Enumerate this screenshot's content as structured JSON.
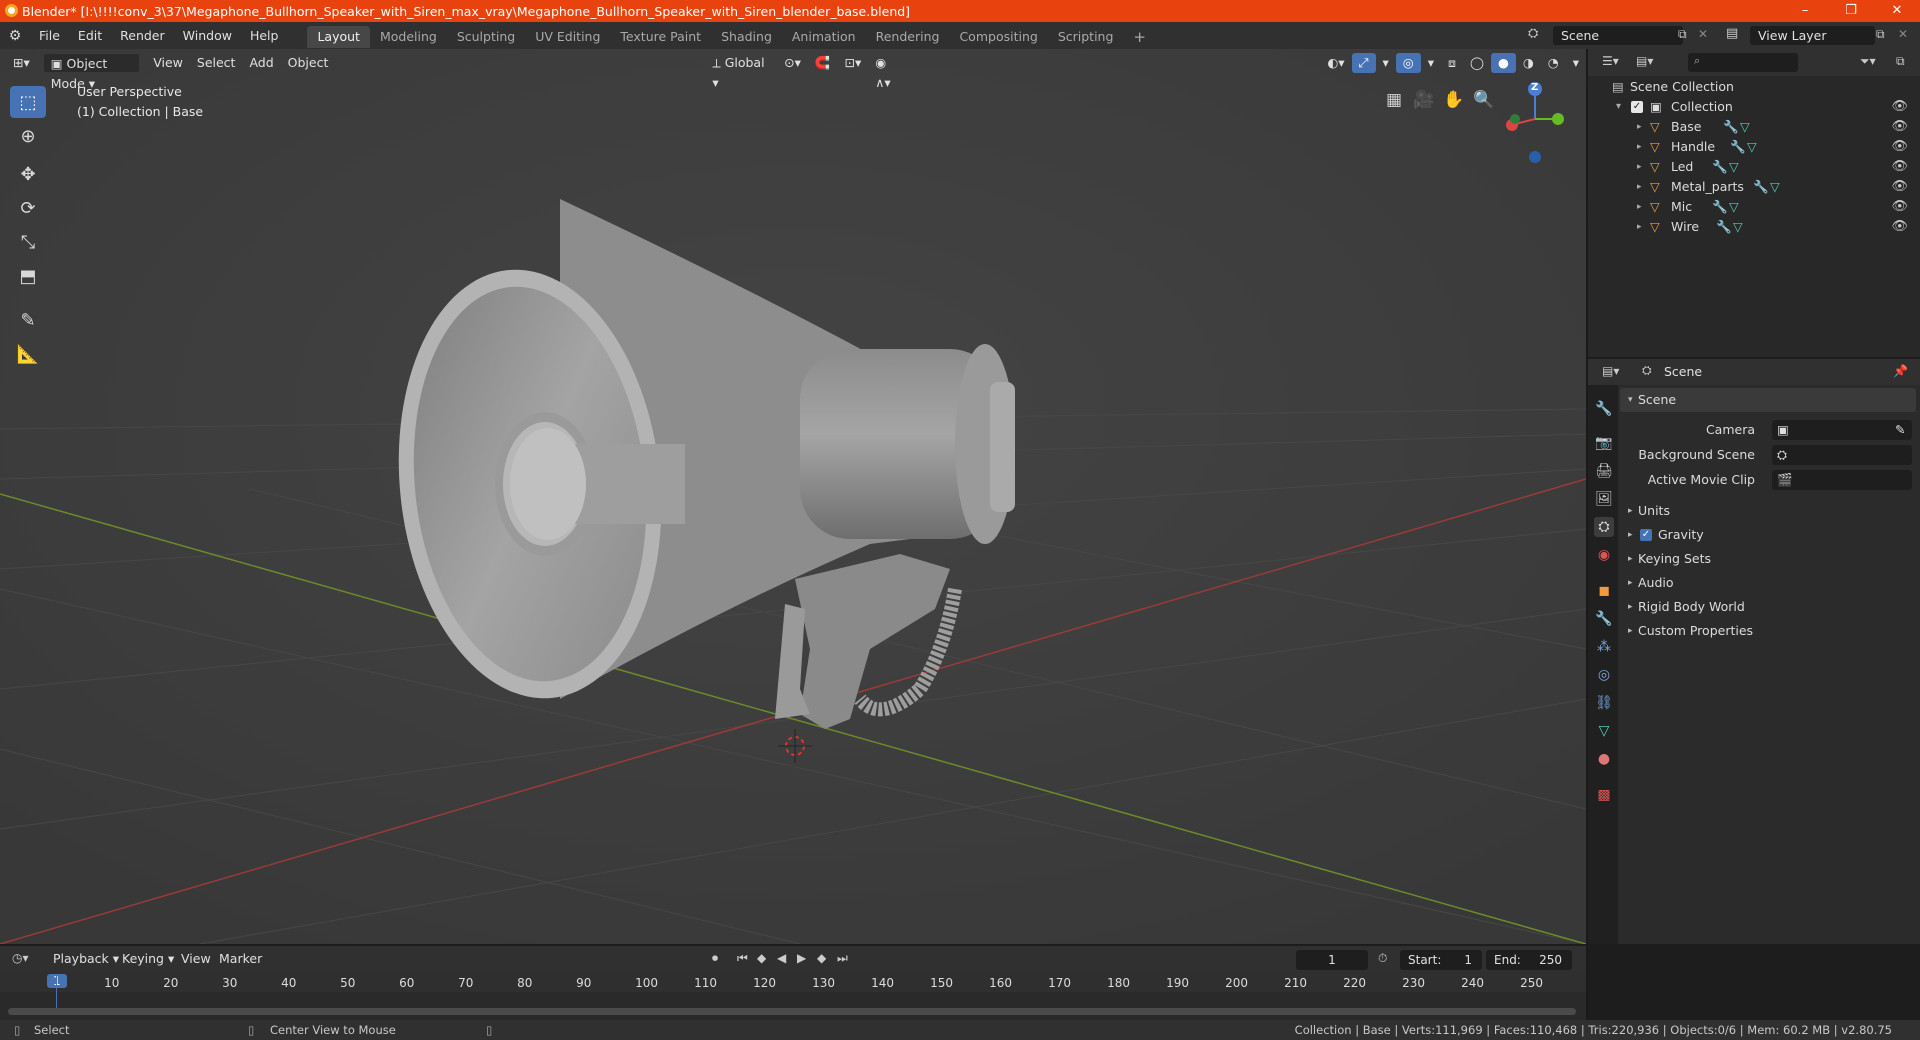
{
  "window": {
    "title": "Blender* [I:\\!!!!conv_3\\37\\Megaphone_Bullhorn_Speaker_with_Siren_max_vray\\Megaphone_Bullhorn_Speaker_with_Siren_blender_base.blend]",
    "minimize": "–",
    "maximize": "❐",
    "close": "✕"
  },
  "menubar": {
    "items": [
      "File",
      "Edit",
      "Render",
      "Window",
      "Help"
    ],
    "workspaces": [
      "Layout",
      "Modeling",
      "Sculpting",
      "UV Editing",
      "Texture Paint",
      "Shading",
      "Animation",
      "Rendering",
      "Compositing",
      "Scripting"
    ],
    "active_workspace": "Layout",
    "add_workspace": "+",
    "scene_name": "Scene",
    "view_layer": "View Layer"
  },
  "viewport_header": {
    "mode": "Object Mode",
    "menus": [
      "View",
      "Select",
      "Add",
      "Object"
    ],
    "transform_orientation": "Global"
  },
  "viewport": {
    "perspective_label": "User Perspective",
    "collection_label": "(1) Collection | Base",
    "gizmo_z": "Z"
  },
  "outliner": {
    "root": "Scene Collection",
    "collection": "Collection",
    "objects": [
      "Base",
      "Handle",
      "Led",
      "Metal_parts",
      "Mic",
      "Wire"
    ]
  },
  "properties": {
    "header": "Scene",
    "panel_title": "Scene",
    "fields": [
      {
        "label": "Camera",
        "value": ""
      },
      {
        "label": "Background Scene",
        "value": ""
      },
      {
        "label": "Active Movie Clip",
        "value": ""
      }
    ],
    "subpanels": [
      "Units",
      "Gravity",
      "Keying Sets",
      "Audio",
      "Rigid Body World",
      "Custom Properties"
    ],
    "gravity_checked": true
  },
  "timeline": {
    "menus": [
      "Playback",
      "Keying",
      "View",
      "Marker"
    ],
    "current_frame": "1",
    "start_label": "Start:",
    "start": "1",
    "end_label": "End:",
    "end": "250",
    "ruler": [
      "1",
      "10",
      "20",
      "30",
      "40",
      "50",
      "60",
      "70",
      "80",
      "90",
      "100",
      "110",
      "120",
      "130",
      "140",
      "150",
      "160",
      "170",
      "180",
      "190",
      "200",
      "210",
      "220",
      "230",
      "240",
      "250"
    ]
  },
  "statusbar": {
    "left_action": "Select",
    "middle_action": "Center View to Mouse",
    "stats": "Collection | Base | Verts:111,969 | Faces:110,468 | Tris:220,936 | Objects:0/6 | Mem: 60.2 MB | v2.80.75"
  },
  "colors": {
    "accent": "#4772b3",
    "title_bar": "#e8420e",
    "x_axis": "#9a3a3a",
    "y_axis": "#6c8a2a"
  }
}
